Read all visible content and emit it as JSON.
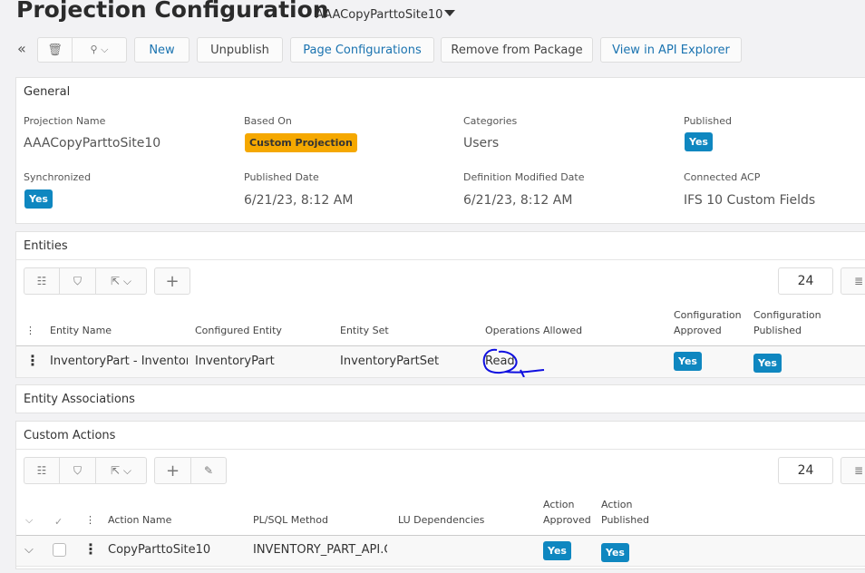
{
  "header": {
    "title": "Projection Configuration",
    "subtitle": "AAACopyParttoSite10"
  },
  "toolbar": {
    "new": "New",
    "unpublish": "Unpublish",
    "page_configurations": "Page Configurations",
    "remove_from_package": "Remove from Package",
    "view_in_api_explorer": "View in API Explorer"
  },
  "general": {
    "title": "General",
    "fields": [
      {
        "label": "Projection Name",
        "value": "AAACopyParttoSite10"
      },
      {
        "label": "Based On",
        "value": "Custom Projection"
      },
      {
        "label": "Categories",
        "value": "Users"
      },
      {
        "label": "Published",
        "value": "Yes"
      },
      {
        "label": "Synchronized",
        "value": "Yes"
      },
      {
        "label": "Published Date",
        "value": "6/21/23, 8:12 AM"
      },
      {
        "label": "Definition Modified Date",
        "value": "6/21/23, 8:12 AM"
      },
      {
        "label": "Connected ACP",
        "value": "IFS 10 Custom Fields"
      }
    ]
  },
  "entities": {
    "title": "Entities",
    "page_size": "24",
    "columns": [
      "Entity Name",
      "Configured Entity",
      "Entity Set",
      "Operations Allowed",
      "Configuration",
      "Approved",
      "Configuration",
      "Published"
    ],
    "rows": [
      {
        "entity_name": "InventoryPart - Inventory",
        "configured_entity": "InventoryPart",
        "entity_set": "InventoryPartSet",
        "operations": "Read",
        "approved": "Yes",
        "published": "Yes"
      }
    ]
  },
  "entity_associations": {
    "title": "Entity Associations"
  },
  "custom_actions": {
    "title": "Custom Actions",
    "page_size": "24",
    "columns": [
      "Action Name",
      "PL/SQL Method",
      "LU Dependencies",
      "Action",
      "Approved",
      "Action",
      "Published"
    ],
    "rows": [
      {
        "action_name": "CopyParttoSite10",
        "method": "INVENTORY_PART_API.CO",
        "lu": "",
        "approved": "Yes",
        "published": "Yes"
      }
    ]
  }
}
